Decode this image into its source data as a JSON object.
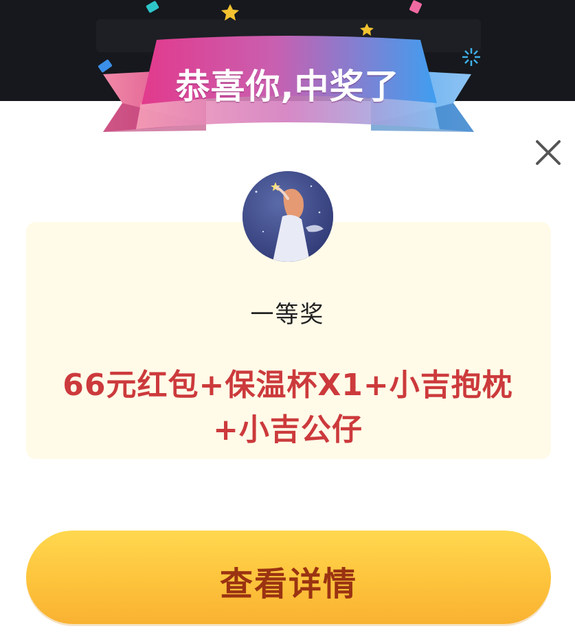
{
  "banner": {
    "title": "恭喜你,中奖了"
  },
  "dialog": {
    "close_icon": "close-icon"
  },
  "prize": {
    "level": "一等奖",
    "content": "66元红包+保温杯X1+小吉抱枕+小吉公仔"
  },
  "actions": {
    "detail_label": "查看详情"
  },
  "colors": {
    "prize_text": "#cc3a3c",
    "card_bg": "#fffbe8",
    "button_gradient_top": "#ffd84f",
    "button_gradient_bottom": "#f9b232",
    "button_text": "#9a3312",
    "ribbon_pink": "#e23d86",
    "ribbon_blue": "#4a9cf0"
  }
}
